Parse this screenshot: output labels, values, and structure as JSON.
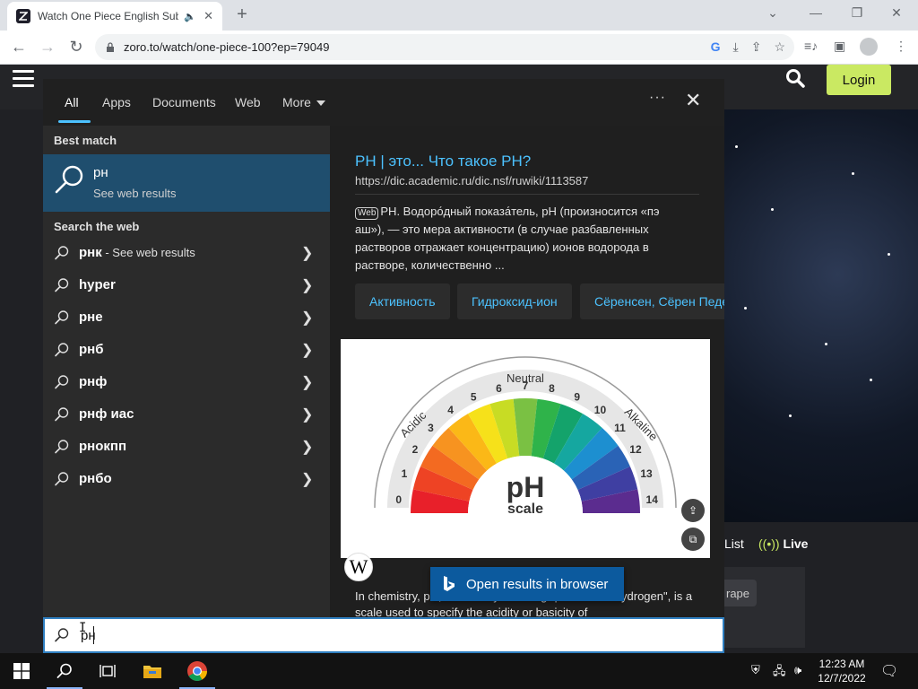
{
  "browser": {
    "tab_title": "Watch One Piece English Sub",
    "tab_audio_icon": "speaker-icon",
    "tab_close": "✕",
    "new_tab": "+",
    "url": "zoro.to/watch/one-piece-100?ep=79049"
  },
  "site": {
    "login_label": "Login",
    "list_label": "List",
    "live_label": "Live",
    "chip_label": "rape",
    "accent_color": "#cae962"
  },
  "search": {
    "tabs": [
      "All",
      "Apps",
      "Documents",
      "Web",
      "More"
    ],
    "active_tab": "All",
    "best_match_heading": "Best match",
    "best_match": {
      "title": "рн",
      "subtitle": "See web results"
    },
    "web_heading": "Search the web",
    "web_results": [
      {
        "text": "рнк",
        "suffix": " - See web results"
      },
      {
        "text": "hyper",
        "suffix": ""
      },
      {
        "text": "рне",
        "suffix": ""
      },
      {
        "text": "рнб",
        "suffix": ""
      },
      {
        "text": "рнф",
        "suffix": ""
      },
      {
        "text": "рнф иас",
        "suffix": ""
      },
      {
        "text": "рнокпп",
        "suffix": ""
      },
      {
        "text": "рнбо",
        "suffix": ""
      }
    ],
    "preview": {
      "title": "PH | это... Что такое PH?",
      "url": "https://dic.academic.ru/dic.nsf/ruwiki/1113587",
      "web_tag": "Web",
      "description": "PH. Водоро́дный показа́тель, pH (произносится «пэ аш»), — это мера активности (в случае разбавленных растворов отражает концентрацию) ионов водорода в растворе, количественно ...",
      "chips": [
        "Активность",
        "Гидроксид-ион",
        "Сёренсен, Сёрен Педер Лауриц"
      ],
      "image": {
        "label_main": "pH",
        "label_sub": "scale",
        "acidic": "Acidic",
        "neutral": "Neutral",
        "alkaline": "Alkaline",
        "numbers": [
          "0",
          "1",
          "2",
          "3",
          "4",
          "5",
          "6",
          "7",
          "8",
          "9",
          "10",
          "11",
          "12",
          "13",
          "14"
        ]
      },
      "wiki_badge": "W",
      "body_text": "In chemistry, pH, historically denoting \"potential of hydrogen\", is a scale used to specify the acidity or basicity of"
    },
    "open_browser_label": "Open results in browser",
    "query": "рн",
    "accent_color": "#4cc2ff",
    "highlight_color": "#1f4e6e"
  },
  "taskbar": {
    "time": "12:23 AM",
    "date": "12/7/2022"
  }
}
